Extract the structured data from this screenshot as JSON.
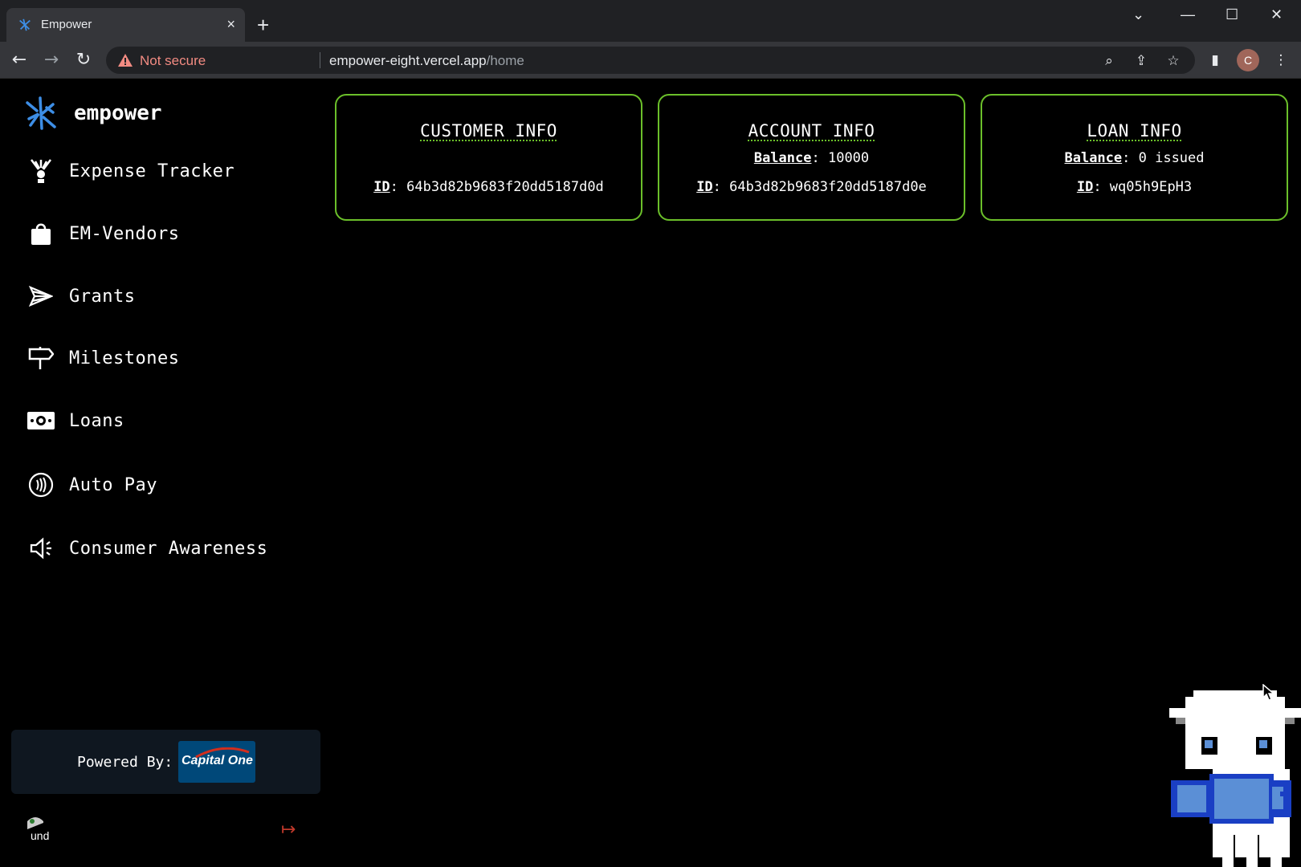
{
  "browser": {
    "tab_title": "Empower",
    "tab_close": "×",
    "new_tab": "+",
    "security_label": "Not secure",
    "url_host": "empower-eight.vercel.app",
    "url_path": "/home",
    "profile_initial": "C"
  },
  "app": {
    "brand_name": "empower"
  },
  "sidebar": {
    "items": [
      {
        "label": "Expense Tracker",
        "icon": "expense-tracker-icon"
      },
      {
        "label": "EM-Vendors",
        "icon": "shopping-bag-icon"
      },
      {
        "label": "Grants",
        "icon": "paper-plane-icon"
      },
      {
        "label": "Milestones",
        "icon": "signpost-icon"
      },
      {
        "label": "Loans",
        "icon": "money-bill-icon"
      },
      {
        "label": "Auto Pay",
        "icon": "contactless-icon"
      },
      {
        "label": "Consumer Awareness",
        "icon": "megaphone-icon"
      }
    ],
    "powered_by": "Powered By:",
    "partner_logo": "Capital One",
    "avatar_alt": "und"
  },
  "cards": {
    "customer": {
      "title": "CUSTOMER INFO",
      "id_label": "ID",
      "id_value": "64b3d82b9683f20dd5187d0d"
    },
    "account": {
      "title": "ACCOUNT INFO",
      "balance_label": "Balance",
      "balance_value": "10000",
      "id_label": "ID",
      "id_value": "64b3d82b9683f20dd5187d0e"
    },
    "loan": {
      "title": "LOAN INFO",
      "balance_label": "Balance",
      "balance_value": "0 issued",
      "id_label": "ID",
      "id_value": "wq05h9EpH3"
    }
  },
  "colors": {
    "card_border": "#6bbf2a",
    "brand_blue": "#3d8ee6",
    "logout_red": "#c0392b"
  }
}
